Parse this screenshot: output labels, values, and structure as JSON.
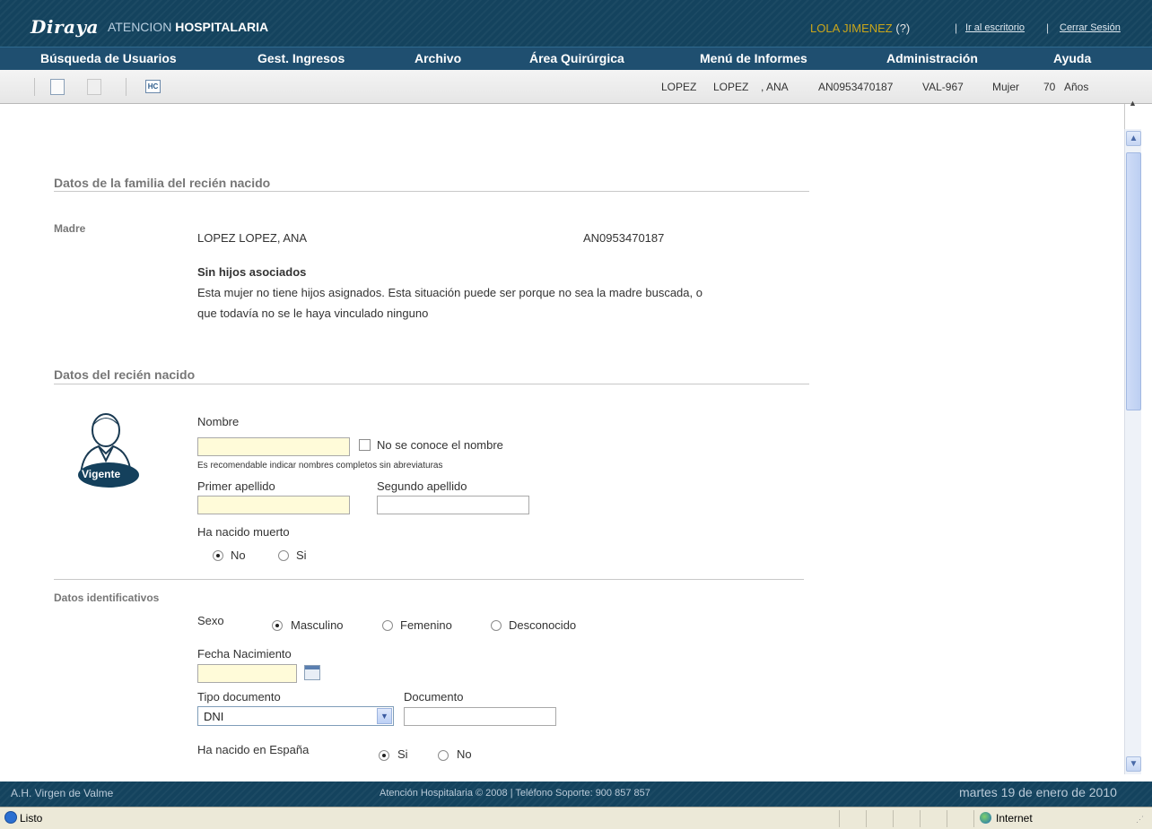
{
  "header": {
    "brand": "Diraya",
    "subtitle_light": "ATENCION ",
    "subtitle_bold": "HOSPITALARIA",
    "user_name": "LOLA JIMENEZ",
    "user_help": " (?)",
    "sep": "|",
    "link_desk": "Ir al escritorio",
    "link_logout": "Cerrar Sesión"
  },
  "nav": {
    "items": [
      "Búsqueda de Usuarios",
      "Gest. Ingresos",
      "Archivo",
      "Área Quirúrgica",
      "Menú de Informes",
      "Administración",
      "Ayuda"
    ]
  },
  "toolbar": {
    "hc_label": "HC",
    "patient": {
      "surname1": "LOPEZ",
      "surname2": "LOPEZ",
      "name": ", ANA",
      "nuhsa": "AN0953470187",
      "code": "VAL-967",
      "sex": "Mujer",
      "age": "70",
      "age_unit": "Años"
    }
  },
  "family": {
    "section_title": "Datos de la familia del recién nacido",
    "mother_label": "Madre",
    "mother_name": "LOPEZ LOPEZ, ANA",
    "mother_nuhsa": "AN0953470187",
    "no_children_title": "Sin hijos asociados",
    "no_children_line1": "Esta mujer no tiene hijos asignados. Esta situación puede ser porque no sea la madre buscada, o",
    "no_children_line2": "que todavía no se le haya vinculado ninguno"
  },
  "newborn": {
    "section_title": "Datos del recién nacido",
    "avatar_badge": "Vigente",
    "name_label": "Nombre",
    "name_value": "",
    "unknown_name_label": "No se conoce el nombre",
    "name_hint": "Es recomendable indicar nombres completos sin abreviaturas",
    "surname1_label": "Primer apellido",
    "surname1_value": "",
    "surname2_label": "Segundo apellido",
    "surname2_value": "",
    "stillborn_label": "Ha nacido muerto",
    "stillborn_no": "No",
    "stillborn_yes": "Si"
  },
  "ident": {
    "section_label": "Datos identificativos",
    "sex_label": "Sexo",
    "sex_male": "Masculino",
    "sex_female": "Femenino",
    "sex_unknown": "Desconocido",
    "birthdate_label": "Fecha Nacimiento",
    "birthdate_value": "",
    "doc_type_label": "Tipo documento",
    "doc_type_selected": "DNI",
    "doc_label": "Documento",
    "doc_value": "",
    "born_spain_label": "Ha nacido en España",
    "born_spain_yes": "Si",
    "born_spain_no": "No"
  },
  "footer": {
    "hospital": "A.H. Virgen de Valme",
    "copyright": "Atención Hospitalaria © 2008 | Teléfono Soporte: 900 857 857",
    "date": "martes 19 de enero de 2010"
  },
  "statusbar": {
    "status": "Listo",
    "zone": "Internet"
  },
  "colors": {
    "header_bg": "#14435e",
    "nav_bg": "#1f4f70",
    "user_name": "#c9a51a",
    "required_field": "#fffbd9"
  }
}
